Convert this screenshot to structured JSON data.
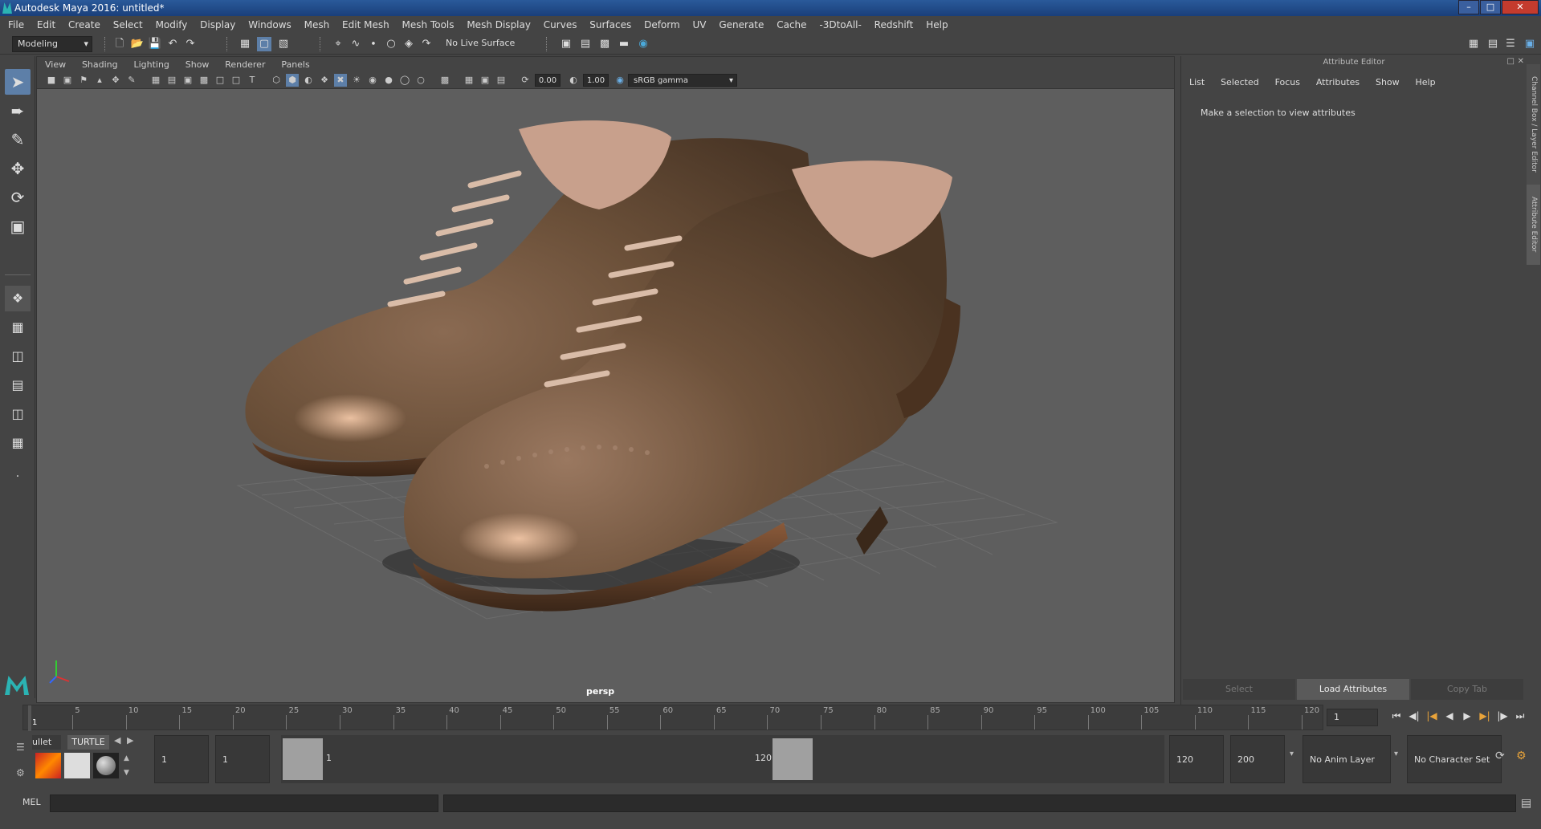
{
  "window": {
    "title": "Autodesk Maya 2016: untitled*"
  },
  "menubar": [
    "File",
    "Edit",
    "Create",
    "Select",
    "Modify",
    "Display",
    "Windows",
    "Mesh",
    "Edit Mesh",
    "Mesh Tools",
    "Mesh Display",
    "Curves",
    "Surfaces",
    "Deform",
    "UV",
    "Generate",
    "Cache",
    "-3DtoAll-",
    "Redshift",
    "Help"
  ],
  "shelf": {
    "mode": "Modeling",
    "live_surface": "No Live Surface"
  },
  "viewport": {
    "menu": [
      "View",
      "Shading",
      "Lighting",
      "Show",
      "Renderer",
      "Panels"
    ],
    "exposure": "0.00",
    "gamma": "1.00",
    "color_space": "sRGB gamma",
    "camera": "persp"
  },
  "attribute_editor": {
    "header": "Attribute Editor",
    "menu": [
      "List",
      "Selected",
      "Focus",
      "Attributes",
      "Show",
      "Help"
    ],
    "message": "Make a selection to view attributes",
    "buttons": [
      "Select",
      "Load Attributes",
      "Copy Tab"
    ],
    "side_tabs": [
      "Channel Box / Layer Editor",
      "Attribute Editor"
    ]
  },
  "timeline": {
    "ticks": [
      "1",
      "5",
      "10",
      "15",
      "20",
      "25",
      "30",
      "35",
      "40",
      "45",
      "50",
      "55",
      "60",
      "65",
      "70",
      "75",
      "80",
      "85",
      "90",
      "95",
      "100",
      "105",
      "110",
      "115",
      "120"
    ],
    "current_frame": "1"
  },
  "range": {
    "shelf_tab_partial": "ullet",
    "shelf_tab_turtle": "TURTLE",
    "start": "1",
    "playback_start": "1",
    "range_start_label": "1",
    "range_end_label": "120",
    "playback_end": "120",
    "end": "200",
    "anim_layer": "No Anim Layer",
    "character_set": "No Character Set"
  },
  "cmdline": {
    "label": "MEL"
  }
}
